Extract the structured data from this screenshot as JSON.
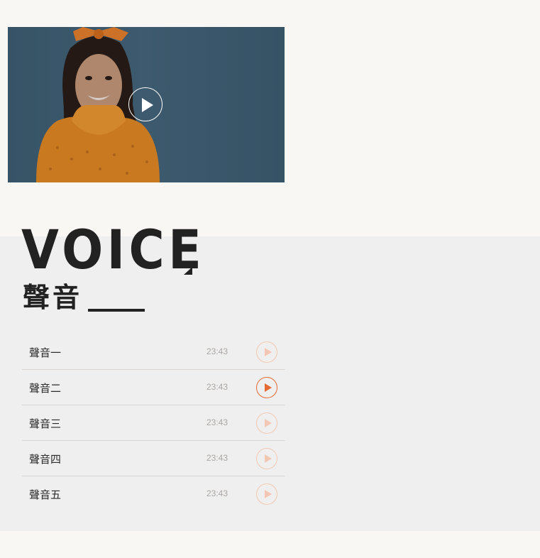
{
  "video": {
    "image": "woman-in-orange-sweater-with-hair-bow",
    "play_icon": "play-circle-icon"
  },
  "voice": {
    "title": "VOICE",
    "subtitle": "聲音"
  },
  "tracks": [
    {
      "name": "聲音一",
      "duration": "23:43",
      "active": false
    },
    {
      "name": "聲音二",
      "duration": "23:43",
      "active": true
    },
    {
      "name": "聲音三",
      "duration": "23:43",
      "active": false
    },
    {
      "name": "聲音四",
      "duration": "23:43",
      "active": false
    },
    {
      "name": "聲音五",
      "duration": "23:43",
      "active": false
    }
  ],
  "colors": {
    "accent": "#e56a33",
    "accent_muted": "#f2c8b5",
    "section_bg": "#f0efef",
    "page_bg": "#f9f7f4",
    "text_dark": "#222222"
  }
}
